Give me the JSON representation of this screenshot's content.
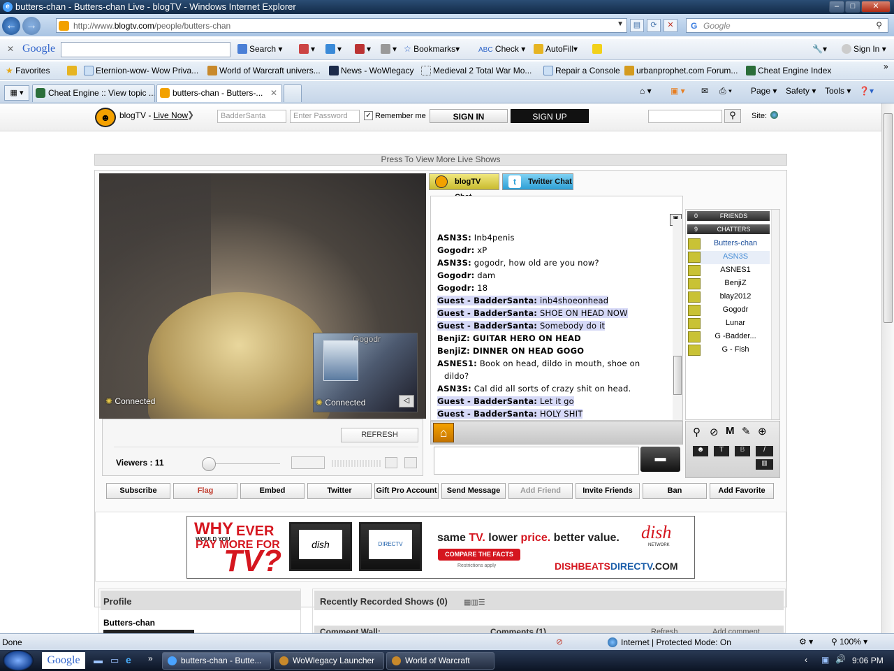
{
  "window": {
    "title": "butters-chan - Butters-chan Live - blogTV - Windows Internet Explorer"
  },
  "address": {
    "url_prefix": "http://www.",
    "url_domain": "blogtv.com",
    "url_path": "/people/butters-chan",
    "search_placeholder": "Google"
  },
  "google_toolbar": {
    "brand": "Google",
    "search_label": "Search",
    "bookmarks_label": "Bookmarks",
    "check_label": "Check",
    "autofill_label": "AutoFill",
    "signin_label": "Sign In"
  },
  "favorites": {
    "label": "Favorites",
    "items": [
      "Eternion-wow- Wow Priva...",
      "World of Warcraft univers...",
      "News - WoWlegacy",
      "Medieval 2 Total War Mo...",
      "Repair a Console",
      "urbanprophet.com Forum...",
      "Cheat Engine  Index"
    ]
  },
  "tabs": [
    {
      "label": "Cheat Engine :: View topic ..."
    },
    {
      "label": "butters-chan - Butters-..."
    }
  ],
  "commands": {
    "page": "Page",
    "safety": "Safety",
    "tools": "Tools"
  },
  "blogtv": {
    "brand": "blogTV",
    "separator": " - ",
    "live_now": "Live Now",
    "username_value": "BadderSanta",
    "password_placeholder": "Enter Password",
    "remember_me": "Remember me",
    "sign_in": "SIGN IN",
    "sign_up": "SIGN UP",
    "site_label": "Site:"
  },
  "live_shows_bar": "Press To View More Live Shows",
  "video": {
    "pip_name": "Gogodr",
    "status_main": "Connected",
    "status_pip": "Connected",
    "refresh": "REFRESH",
    "viewers": "Viewers : 11"
  },
  "chat": {
    "tab_blogtv": "blogTV Chat",
    "tab_twitter": "Twitter Chat",
    "messages": [
      {
        "name": "ASN3S:",
        "text": "Inb4penis",
        "hl": false
      },
      {
        "name": "Gogodr:",
        "text": "xP",
        "hl": false
      },
      {
        "name": "ASN3S:",
        "text": "gogodr, how old are you now?",
        "hl": false
      },
      {
        "name": "Gogodr:",
        "text": "dam",
        "hl": false
      },
      {
        "name": "Gogodr:",
        "text": "18",
        "hl": false
      },
      {
        "name": "Guest - BadderSanta:",
        "text": "inb4shoeonhead",
        "hl": true
      },
      {
        "name": "Guest - BadderSanta:",
        "text": "SHOE ON HEAD NOW",
        "hl": true
      },
      {
        "name": "Guest - BadderSanta:",
        "text": "Somebody do it",
        "hl": true
      },
      {
        "name": "BenjiZ:",
        "text": "GUITAR HERO ON HEAD",
        "hl": false,
        "bold": true
      },
      {
        "name": "BenjiZ:",
        "text": "DINNER ON HEAD GOGO",
        "hl": false,
        "bold": true
      },
      {
        "name": "ASNES1:",
        "text": "Book on head, dildo in mouth, shoe on",
        "hl": false
      },
      {
        "name": "",
        "text": "dildo?",
        "hl": false
      },
      {
        "name": "ASN3S:",
        "text": "Cal did all sorts of crazy shit on head.",
        "hl": false
      },
      {
        "name": "Guest - BadderSanta:",
        "text": "Let it go",
        "hl": true
      },
      {
        "name": "Guest - BadderSanta:",
        "text": "HOLY SHIT",
        "hl": true
      }
    ]
  },
  "userlist": {
    "friends_count": "0",
    "friends_label": "FRIENDS",
    "chatters_count": "9",
    "chatters_label": "CHATTERS",
    "users": [
      "Butters-chan",
      "ASN3S",
      "ASNES1",
      "BenjiZ",
      "blay2012",
      "Gogodr",
      "Lunar",
      "G -Badder...",
      "G - Fish"
    ]
  },
  "actions": [
    "Subscribe",
    "Flag",
    "Embed",
    "Twitter",
    "Gift Pro Account",
    "Send Message",
    "Add Friend",
    "Invite Friends",
    "Ban",
    "Add Favorite"
  ],
  "ad": {
    "why": "WHY",
    "would_you": "WOULD YOU",
    "ever": "EVER",
    "pay_more": "PAY MORE FOR",
    "tv": "TV?",
    "tagline_1": "same ",
    "tagline_tv": "TV.",
    "tagline_2": " lower ",
    "tagline_price": "price.",
    "tagline_3": " better value.",
    "compare": "COMPARE THE FACTS",
    "restrictions": "Restrictions apply",
    "dish": "dish",
    "network": "NETWORK",
    "url_1": "DISHBEATS",
    "url_2": "DIRECTV",
    "url_3": ".COM",
    "tv_dish": "dish",
    "tv_directv": "DIRECTV"
  },
  "profile": {
    "header": "Profile",
    "name": "Butters-chan"
  },
  "recent": {
    "header": "Recently Recorded Shows (0)",
    "comment_wall": "Comment Wall:",
    "comments": "Comments (1)",
    "refresh": "Refresh",
    "add_comment": "Add comment"
  },
  "status": {
    "left": "Done",
    "zone": "Internet | Protected Mode: On",
    "zoom": "100%"
  },
  "taskbar": {
    "google": "Google",
    "items": [
      "butters-chan - Butte...",
      "WoWlegacy Launcher",
      "World of Warcraft"
    ],
    "time": "9:06 PM"
  }
}
